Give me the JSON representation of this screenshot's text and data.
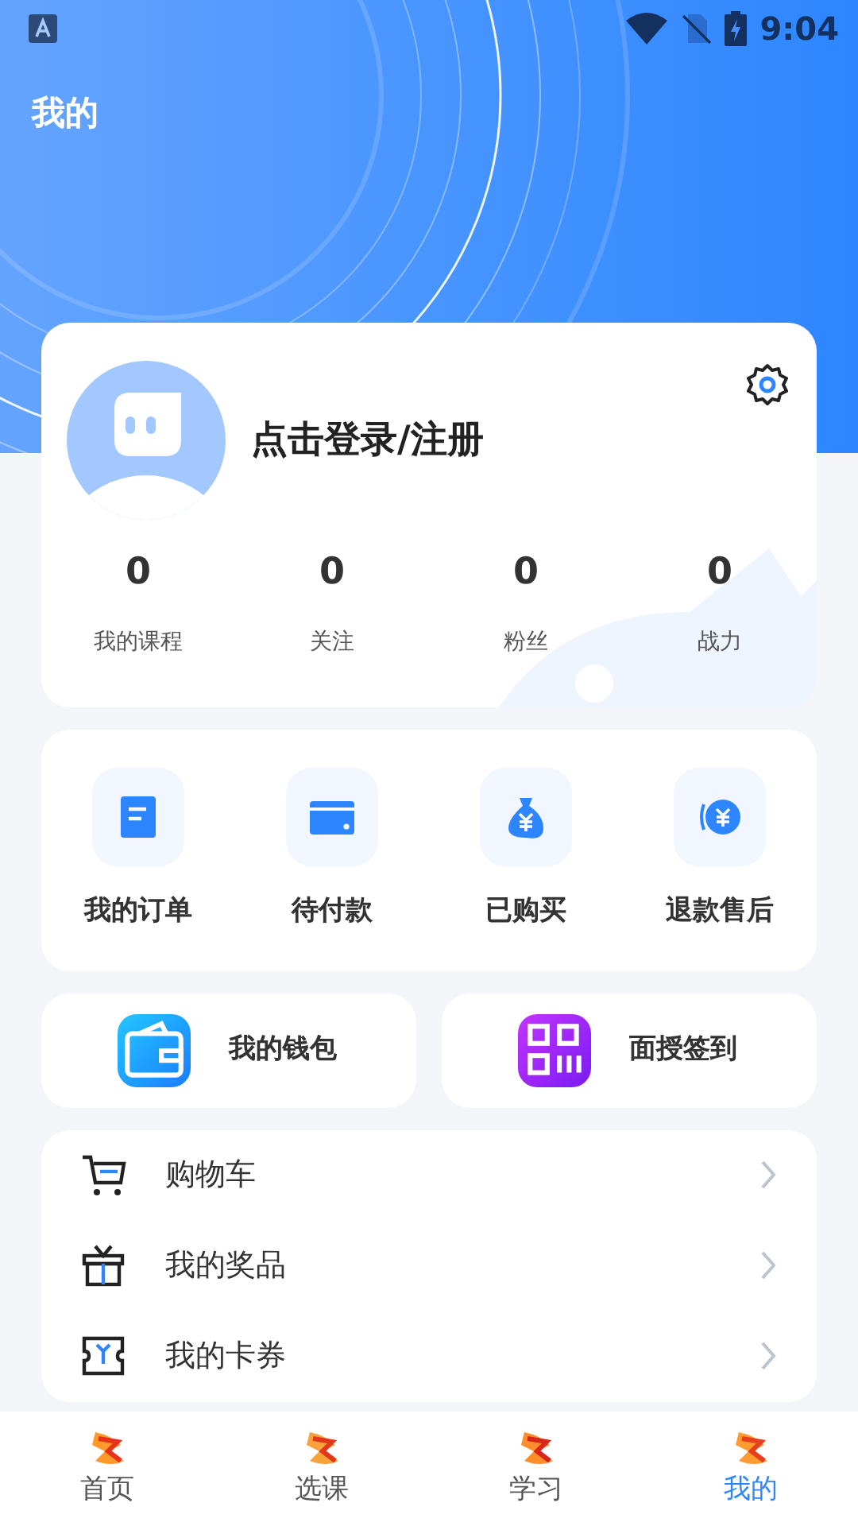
{
  "status_bar": {
    "time": "9:04"
  },
  "header": {
    "title": "我的"
  },
  "profile": {
    "login_text": "点击登录/注册",
    "stats": [
      {
        "value": "0",
        "label": "我的课程"
      },
      {
        "value": "0",
        "label": "关注"
      },
      {
        "value": "0",
        "label": "粉丝"
      },
      {
        "value": "0",
        "label": "战力"
      }
    ]
  },
  "orders": [
    {
      "kind": "doc",
      "label": "我的订单"
    },
    {
      "kind": "card",
      "label": "待付款"
    },
    {
      "kind": "bag",
      "label": "已购买"
    },
    {
      "kind": "refund",
      "label": "退款售后"
    }
  ],
  "shortcuts": [
    {
      "kind": "wallet",
      "label": "我的钱包"
    },
    {
      "kind": "qr",
      "label": "面授签到"
    }
  ],
  "menu": [
    {
      "kind": "cart",
      "label": "购物车"
    },
    {
      "kind": "gift",
      "label": "我的奖品"
    },
    {
      "kind": "coupon",
      "label": "我的卡券"
    }
  ],
  "tabs": [
    {
      "label": "首页",
      "selected": false
    },
    {
      "label": "选课",
      "selected": false
    },
    {
      "label": "学习",
      "selected": false
    },
    {
      "label": "我的",
      "selected": true
    }
  ]
}
